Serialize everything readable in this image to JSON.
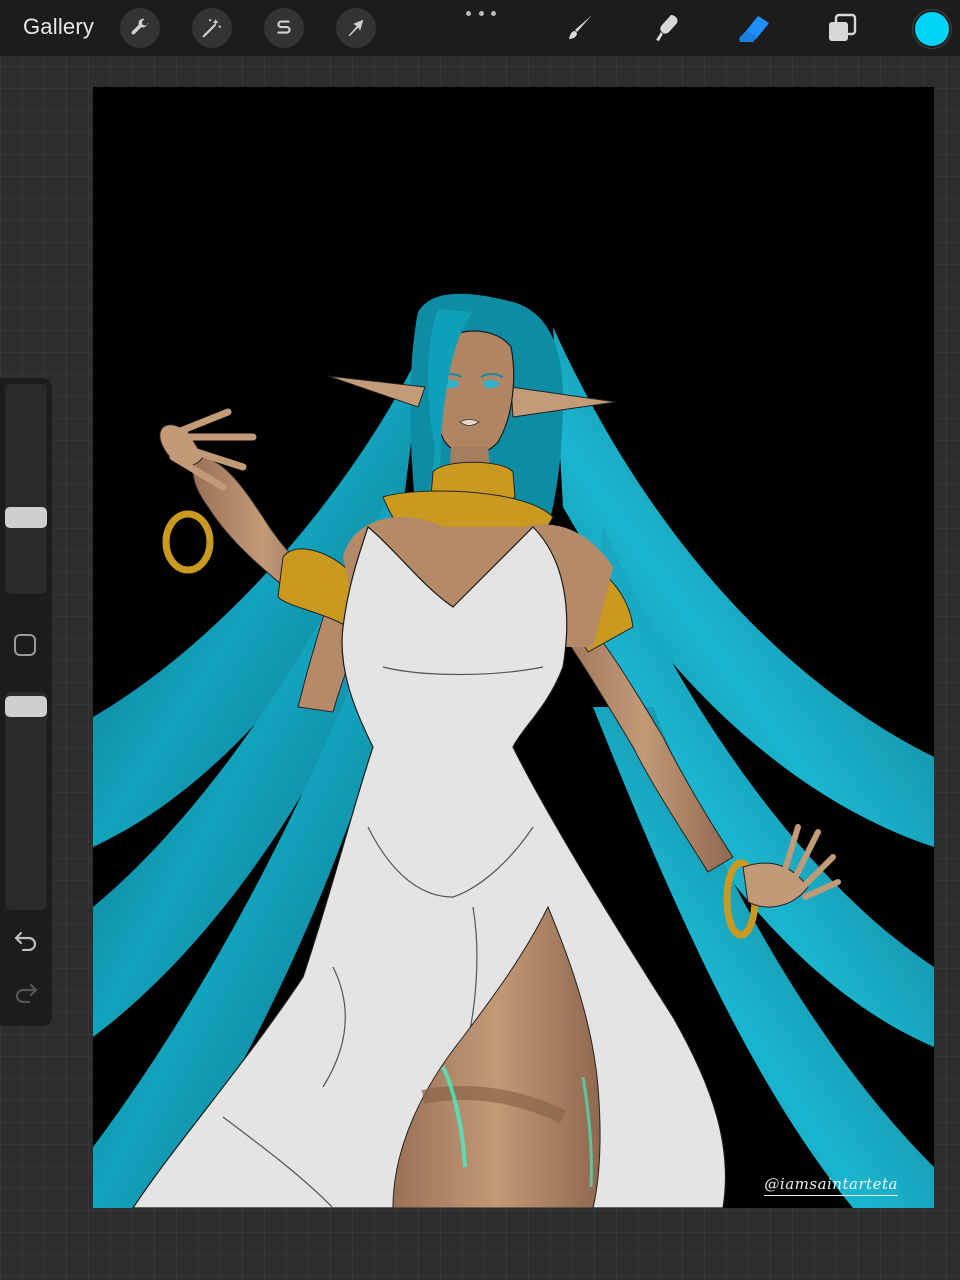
{
  "app": {
    "gallery_label": "Gallery"
  },
  "toolbar": {
    "left_tools": [
      {
        "name": "actions",
        "icon": "wrench-icon"
      },
      {
        "name": "adjustments",
        "icon": "magic-wand-icon"
      },
      {
        "name": "selection",
        "icon": "selection-s-icon"
      },
      {
        "name": "transform",
        "icon": "arrow-cursor-icon"
      }
    ],
    "more_icon": "more-dots-icon",
    "right_tools": [
      {
        "name": "brush",
        "icon": "brush-icon",
        "active": false
      },
      {
        "name": "smudge",
        "icon": "smudge-icon",
        "active": false
      },
      {
        "name": "eraser",
        "icon": "eraser-icon",
        "active": true
      },
      {
        "name": "layers",
        "icon": "layers-icon",
        "active": false
      }
    ],
    "active_color": "#00d4f5"
  },
  "sidebar": {
    "size_slider_level": 0.35,
    "opacity_slider_level": 0.98,
    "modify_button_icon": "square-icon",
    "undo_icon": "undo-icon",
    "redo_icon": "redo-icon"
  },
  "canvas": {
    "background_color": "#000000",
    "artwork": "elf-woman-illustration",
    "signature": "@iamsaintarteta"
  },
  "colors": {
    "toolbar_bg": "#1c1c1c",
    "accent_blue": "#1e8fff",
    "hair_teal": "#0f8fa6",
    "gold": "#c99a1f",
    "dress": "#e8e8e8",
    "skin": "#b98d6a"
  }
}
